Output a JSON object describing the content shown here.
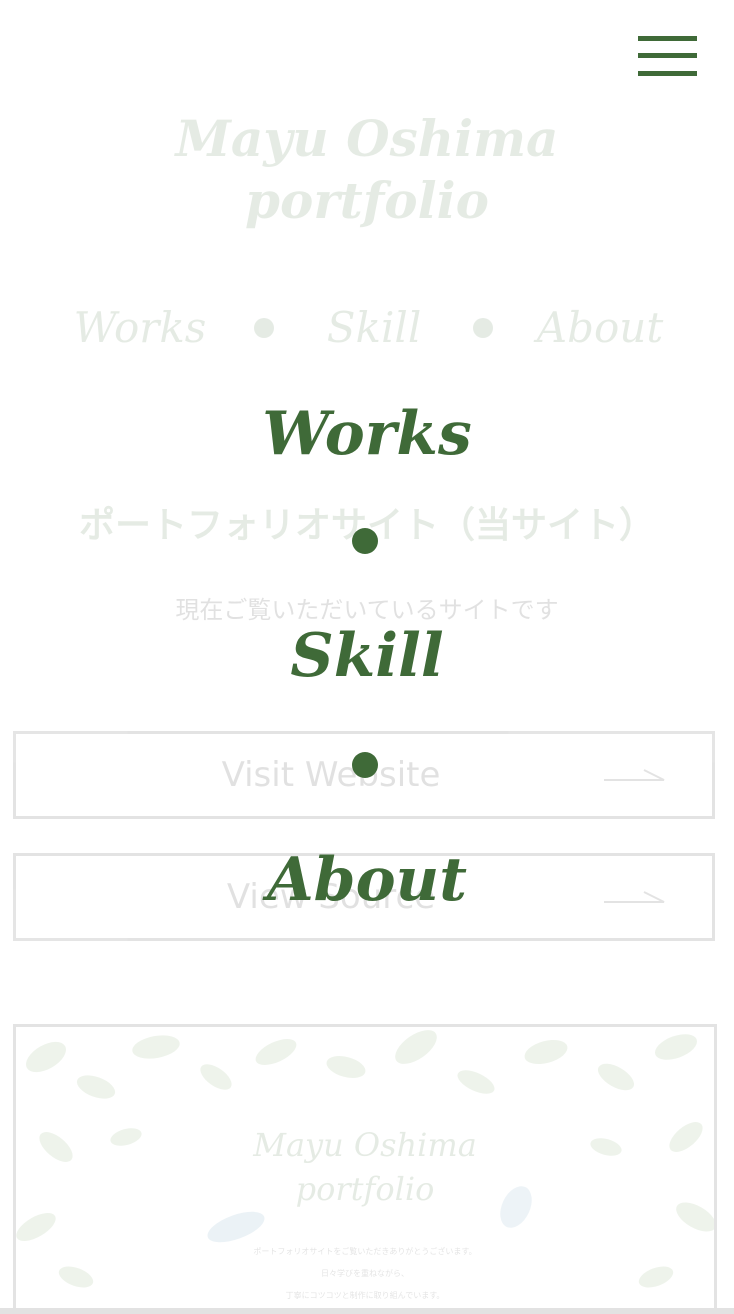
{
  "site": {
    "title_line1": "Mayu Oshima",
    "title_line2": "portfolio"
  },
  "background_nav": {
    "items": [
      "Works",
      "Skill",
      "About"
    ]
  },
  "work": {
    "title": "ポートフォリオサイト（当サイト）",
    "description": "現在ご覧いただいているサイトです",
    "visit_label": "Visit Website",
    "source_label": "View Source"
  },
  "preview": {
    "title_line1": "Mayu Oshima",
    "title_line2": "portfolio",
    "text_lines": [
      "ポートフォリオサイトをご覧いただきありがとうございます。",
      "日々学びを重ねながら、",
      "丁寧にコツコツと制作に取り組んでいます。"
    ]
  },
  "menu": {
    "items": [
      "Works",
      "Skill",
      "About"
    ],
    "toggle_icon": "hamburger-icon"
  },
  "colors": {
    "accent": "#3f6a38",
    "background": "#ffffff",
    "overlay_tint": "rgba(255,255,255,0.87)"
  }
}
